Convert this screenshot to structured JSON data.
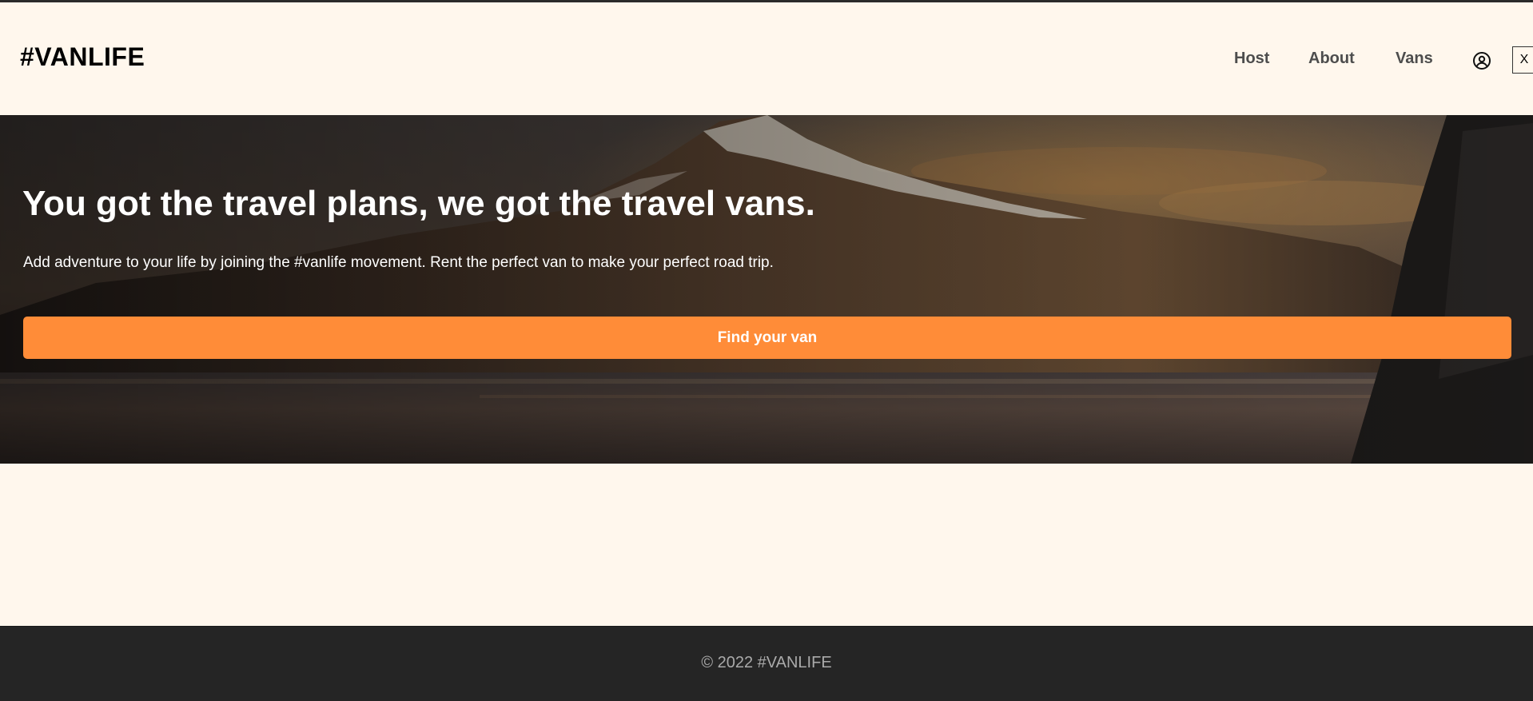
{
  "header": {
    "logo": "#VANLIFE",
    "nav": [
      {
        "label": "Host"
      },
      {
        "label": "About"
      },
      {
        "label": "Vans"
      }
    ],
    "user_icon": "user-circle-icon",
    "close_label": "X"
  },
  "hero": {
    "title": "You got the travel plans, we got the travel vans.",
    "subtitle": "Add adventure to your life by joining the #vanlife movement. Rent the perfect van to make your perfect road trip.",
    "cta_label": "Find your van"
  },
  "footer": {
    "copyright": "© 2022 #VANLIFE"
  },
  "colors": {
    "page_background": "#FFF7ED",
    "accent": "#FF8C38",
    "footer_background": "#252525",
    "footer_text": "#AAAAAA",
    "nav_text": "#4D4D4D"
  }
}
